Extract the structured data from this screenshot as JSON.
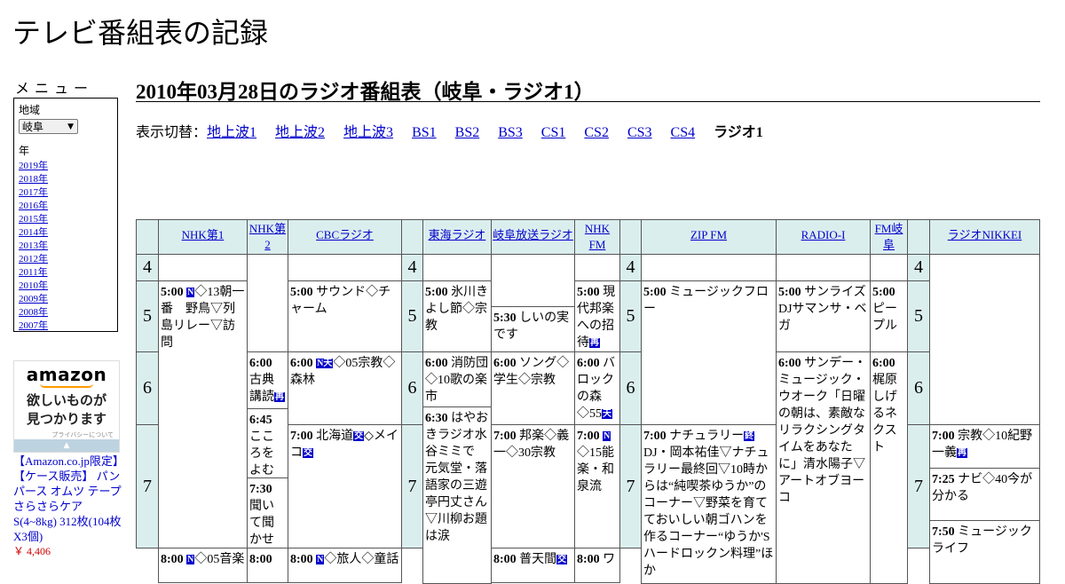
{
  "site_title": "テレビ番組表の記録",
  "menu": {
    "title": "メニュー",
    "region_label": "地域",
    "region_value": "岐阜",
    "year_label": "年",
    "years": [
      "2019年",
      "2018年",
      "2017年",
      "2016年",
      "2015年",
      "2014年",
      "2013年",
      "2012年",
      "2011年",
      "2010年",
      "2009年",
      "2008年",
      "2007年"
    ]
  },
  "ad": {
    "logo": "amazon",
    "text1": "欲しいものが",
    "text2": "見つかります",
    "privacy": "プライバシーについて",
    "product": "【Amazon.co.jp限定】【ケース販売】 パンパース オムツ テープ さらさらケア S(4~8kg) 312枚(104枚X3個)",
    "price": "￥ 4,406"
  },
  "heading": "2010年03月28日のラジオ番組表（岐阜・ラジオ1）",
  "switcher": {
    "label": "表示切替：",
    "links": [
      "地上波1",
      "地上波2",
      "地上波3",
      "BS1",
      "BS2",
      "BS3",
      "CS1",
      "CS2",
      "CS3",
      "CS4"
    ],
    "current": "ラジオ1"
  },
  "stations": [
    "NHK第1",
    "NHK第2",
    "CBCラジオ",
    "東海ラジオ",
    "岐阜放送ラジオ",
    "NHK FM",
    "ZIP FM",
    "RADIO-I",
    "FM岐阜",
    "ラジオNIKKEI"
  ],
  "hours": [
    "4",
    "5",
    "6",
    "7"
  ],
  "programs": {
    "nhk1_0500": {
      "time": "5:00",
      "badge": "N",
      "text": "◇13朝一番　野鳥▽列島リレー▽訪問"
    },
    "nhk1_0800": {
      "time": "8:00",
      "badge": "N",
      "text": "◇05音楽"
    },
    "nhk2_0600": {
      "time": "6:00",
      "text": "古典講読",
      "badge_end": "再"
    },
    "nhk2_0645": {
      "time": "6:45",
      "text": "こころをよむ◇名曲"
    },
    "nhk2_0730": {
      "time": "7:30",
      "text": "聞いて聞かせて",
      "badge_end": "再"
    },
    "nhk2_0800": {
      "time": "8:00",
      "text": ""
    },
    "cbc_0500": {
      "time": "5:00",
      "text": "サウンド◇チャーム"
    },
    "cbc_0600": {
      "time": "6:00",
      "badge": "N天",
      "text": "◇05宗教◇森林"
    },
    "cbc_0700": {
      "time": "7:00",
      "text": "北海道",
      "badge_mid": "交",
      "text2": "◇メイコ",
      "badge_end": "交"
    },
    "cbc_0800": {
      "time": "8:00",
      "badge": "N",
      "text": "◇旅人◇童話"
    },
    "tokai_0500": {
      "time": "5:00",
      "text": "氷川きよし節◇宗教"
    },
    "tokai_0600": {
      "time": "6:00",
      "text": "消防団◇10歌の楽市"
    },
    "tokai_0630": {
      "time": "6:30",
      "text": "はやおきラジオ水谷ミミで　元気堂・落語家の三遊亭円丈さん▽川柳お題は涙"
    },
    "gifu_0530": {
      "time": "5:30",
      "text": "しいの実です"
    },
    "gifu_0600": {
      "time": "6:00",
      "text": "ソング◇学生◇宗教"
    },
    "gifu_0700": {
      "time": "7:00",
      "text": "邦楽◇義一◇30宗教"
    },
    "gifu_0800": {
      "time": "8:00",
      "text": "普天間",
      "badge_end": "交"
    },
    "nhkfm_0500": {
      "time": "5:00",
      "text": "現代邦楽への招待",
      "badge_end": "再"
    },
    "nhkfm_0600": {
      "time": "6:00",
      "text": "バロックの森◇55",
      "badge_end": "天"
    },
    "nhkfm_0700": {
      "time": "7:00",
      "badge": "N",
      "text": "◇15能楽・和泉流"
    },
    "nhkfm_0800": {
      "time": "8:00",
      "text": "ワ"
    },
    "zip_0500": {
      "time": "5:00",
      "text": "ミュージックフロー"
    },
    "zip_0700": {
      "time": "7:00",
      "text": "ナチュラリー",
      "badge_mid": "終",
      "text2": "DJ・岡本祐佳▽ナチュラリー最終回▽10時からは“純喫茶ゆうか”のコーナー▽野菜を育てておいしい朝ゴハンを作るコーナー“ゆうか'Sハードロックン料理”ほか"
    },
    "radioi_0500": {
      "time": "5:00",
      "text": "サンライズDJサマンサ・ベガ"
    },
    "radioi_0600": {
      "time": "6:00",
      "text": "サンデー・ミュージック・ウオーク「日曜の朝は、素敵なリラクシングタイムをあなたに」清水陽子▽アートオブヨーコ"
    },
    "fmgifu_0500": {
      "time": "5:00",
      "text": "ピープル"
    },
    "fmgifu_0600": {
      "time": "6:00",
      "text": "梶原しげるネクスト"
    },
    "nikkei_0700": {
      "time": "7:00",
      "text": "宗教◇10紀野一義",
      "badge_end": "再"
    },
    "nikkei_0725": {
      "time": "7:25",
      "text": "ナビ◇40今が分かる"
    },
    "nikkei_0750": {
      "time": "7:50",
      "text": "ミュージックライフ"
    }
  }
}
